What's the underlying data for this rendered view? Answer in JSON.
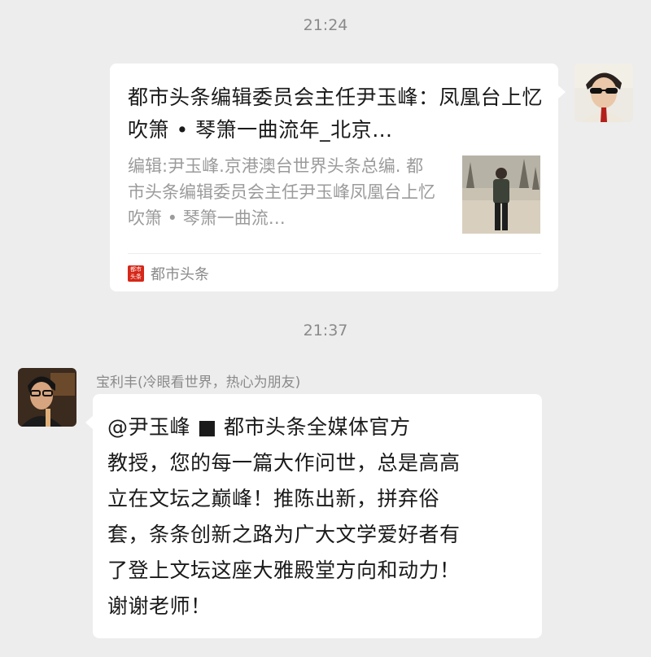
{
  "messages": {
    "time1": "21:24",
    "time2": "21:37"
  },
  "link_card": {
    "title": "都市头条编辑委员会主任尹玉峰：凤凰台上忆吹箫 • 琴箫一曲流年_北京…",
    "description": "编辑:尹玉峰.京港澳台世界头条总编. 都市头条编辑委员会主任尹玉峰凤凰台上忆吹箫 • 琴箫一曲流…",
    "source_name": "都市头条",
    "source_logo_text": "都市头条"
  },
  "incoming": {
    "sender": "宝利丰(冷眼看世界，热心为朋友)",
    "text": "@尹玉峰 ■ 都市头条全媒体官方\n教授，您的每一篇大作问世，总是高高\n立在文坛之巅峰！推陈出新，拼弃俗\n套，条条创新之路为广大文学爱好者有\n了登上文坛这座大雅殿堂方向和动力！\n谢谢老师！"
  },
  "colors": {
    "background": "#ededed",
    "bubble": "#ffffff",
    "source_red": "#d62718"
  }
}
